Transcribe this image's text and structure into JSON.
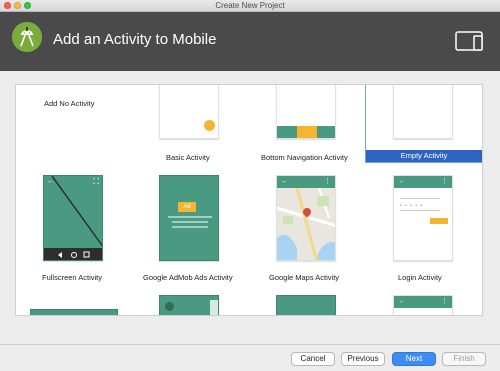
{
  "window": {
    "title": "Create New Project"
  },
  "header": {
    "title": "Add an Activity to Mobile"
  },
  "activities": {
    "no_activity": "Add No Activity",
    "basic": "Basic Activity",
    "bottom_nav": "Bottom Navigation Activity",
    "empty": "Empty Activity",
    "fullscreen": "Fullscreen Activity",
    "admob": "Google AdMob Ads Activity",
    "maps": "Google Maps Activity",
    "login": "Login Activity"
  },
  "admob_badge": "Ad",
  "selected": "Empty Activity",
  "buttons": {
    "cancel": "Cancel",
    "previous": "Previous",
    "next": "Next",
    "finish": "Finish"
  },
  "colors": {
    "header": "#4a4a4a",
    "accent_teal": "#4a9a82",
    "selection": "#2d64c4",
    "primary_button": "#3d8cf5",
    "fab_yellow": "#f4b630"
  },
  "icons": {
    "window_close": "red-traffic-light-icon",
    "android_logo": "android-studio-icon",
    "device": "tablet-phone-icon",
    "back": "arrow-left-icon",
    "overflow": "overflow-menu-icon",
    "fullscreen": "fullscreen-icon",
    "map_pin": "map-pin-icon"
  }
}
